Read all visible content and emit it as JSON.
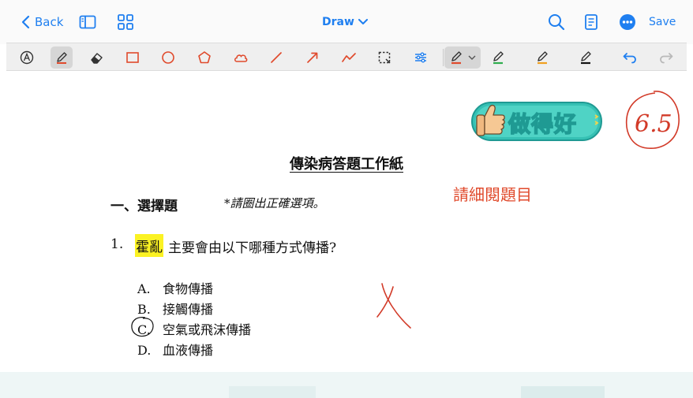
{
  "nav": {
    "back_label": "Back",
    "mode_label": "Draw",
    "save_label": "Save"
  },
  "toolbar": {
    "tools": [
      "auto-shape",
      "pen",
      "eraser",
      "rectangle",
      "circle",
      "pentagon",
      "cloud",
      "line",
      "arrow",
      "polyline",
      "lasso-select",
      "adjust",
      "highlighter-red",
      "pen-green",
      "pen-orange",
      "pen-black",
      "undo",
      "redo"
    ],
    "active_tool": "pen"
  },
  "worksheet": {
    "title": "傳染病答題工作紙",
    "section_heading": "一、選擇題",
    "section_instruction": "*請圈出正確選項。",
    "question": {
      "number": "1.",
      "keyword": "霍亂",
      "text": "主要會由以下哪種方式傳播?",
      "options": [
        {
          "letter": "A.",
          "text": "食物傳播"
        },
        {
          "letter": "B.",
          "text": "接觸傳播"
        },
        {
          "letter": "C.",
          "text": "空氣或飛沫傳播"
        },
        {
          "letter": "D.",
          "text": "血液傳播"
        }
      ]
    }
  },
  "annotations": {
    "teacher_note": "請細閱題目",
    "sticker_text": "做得好",
    "score": "6.5"
  },
  "colors": {
    "accent": "#1f7ff0",
    "annotation_red": "#e04a2c",
    "highlight": "#fbf223",
    "sticker_teal": "#1f9a93"
  }
}
